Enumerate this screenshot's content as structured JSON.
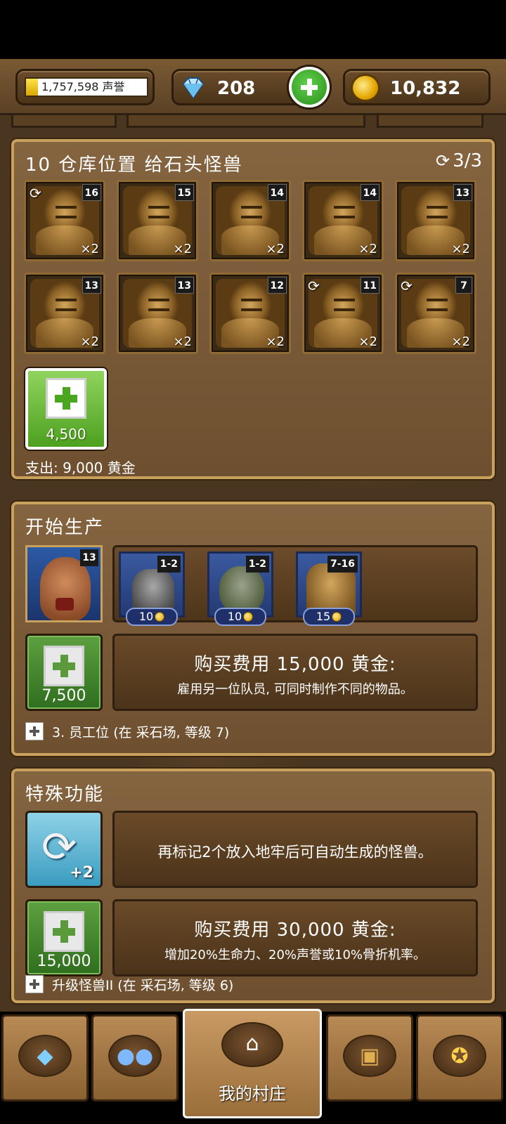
{
  "header": {
    "fame_value": "1,757,598 声誉",
    "fame_progress": 0.1,
    "gems": "208",
    "gold": "10,832",
    "icons": {
      "gem": "diamond-icon",
      "gold": "gold-coin-icon",
      "add": "plus-icon"
    }
  },
  "storage": {
    "title": "10 仓库位置 给石头怪兽",
    "refresh": "3/3",
    "slots": [
      {
        "level": "16",
        "qty": "×2",
        "auto": true
      },
      {
        "level": "15",
        "qty": "×2",
        "auto": false
      },
      {
        "level": "14",
        "qty": "×2",
        "auto": false
      },
      {
        "level": "14",
        "qty": "×2",
        "auto": false
      },
      {
        "level": "13",
        "qty": "×2",
        "auto": false
      },
      {
        "level": "13",
        "qty": "×2",
        "auto": false
      },
      {
        "level": "13",
        "qty": "×2",
        "auto": false
      },
      {
        "level": "12",
        "qty": "×2",
        "auto": false
      },
      {
        "level": "11",
        "qty": "×2",
        "auto": true
      },
      {
        "level": "7",
        "qty": "×2",
        "auto": true
      }
    ],
    "add_slot_price": "4,500",
    "cost": "支出: 9,000 黄金"
  },
  "production": {
    "title": "开始生产",
    "worker_level": "13",
    "items": [
      {
        "monster": "gargoyle",
        "range": "1-2",
        "price": "10"
      },
      {
        "monster": "troll",
        "range": "1-2",
        "price": "10"
      },
      {
        "monster": "golem",
        "range": "7-16",
        "price": "15"
      }
    ],
    "hire_price": "7,500",
    "hire_title": "购买费用 15,000 黄金:",
    "hire_desc": "雇用另一位队员, 可同时制作不同的物品。",
    "requirement": "3. 员工位 (在 采石场, 等级 7)"
  },
  "special": {
    "title": "特殊功能",
    "auto_badge": "+2",
    "auto_desc": "再标记2个放入地牢后可自动生成的怪兽。",
    "upgrade_price": "15,000",
    "upgrade_title": "购买费用 30,000 黄金:",
    "upgrade_desc": "增加20%生命力、20%声誉或10%骨折机率。",
    "requirement": "升级怪兽II (在 采石场, 等级 6)"
  },
  "nav": {
    "tabs": [
      {
        "icon": "gem-icon"
      },
      {
        "icon": "team-icon"
      },
      {
        "icon": "home-icon",
        "label": "我的村庄"
      },
      {
        "icon": "treasure-chest-icon"
      },
      {
        "icon": "medal-icon"
      }
    ]
  }
}
